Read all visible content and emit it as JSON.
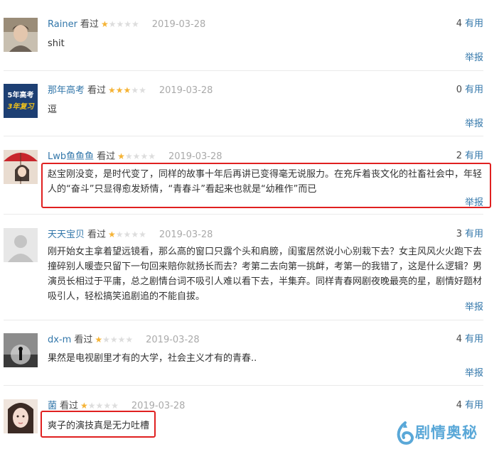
{
  "reviews": [
    {
      "username": "Rainer",
      "watched_label": "看过",
      "rating": 1,
      "date": "2019-03-28",
      "useful_count": "4",
      "useful_label": "有用",
      "content": "shit",
      "report_label": "举报"
    },
    {
      "username": "那年高考",
      "watched_label": "看过",
      "rating": 3,
      "date": "2019-03-28",
      "useful_count": "0",
      "useful_label": "有用",
      "content": "逗",
      "report_label": "举报",
      "avatar_text": [
        "5年高考",
        "3年复习"
      ]
    },
    {
      "username": "Lwb鱼鱼鱼",
      "watched_label": "看过",
      "rating": 1,
      "date": "2019-03-28",
      "useful_count": "2",
      "useful_label": "有用",
      "content": "赵宝刚没变，是时代变了，同样的故事十年后再讲已变得毫无说服力。在充斥着丧文化的社畜社会中，年轻人的“奋斗”只显得愈发矫情，“青春斗”看起来也就是“幼稚作”而已",
      "report_label": "举报"
    },
    {
      "username": "天天宝贝",
      "watched_label": "看过",
      "rating": 1,
      "date": "2019-03-28",
      "useful_count": "3",
      "useful_label": "有用",
      "content": "刚开始女主拿着望远镜看，那么高的窗口只露个头和肩膀，闺蜜居然说小心别栽下去？女主风风火火跑下去撞碎别人暖壶只留下一句回来赔你就扬长而去？考第二去向第一挑衅，考第一的我错了，这是什么逻辑？男演员长相过于平庸，总之剧情台词不吸引人难以看下去，半集弃。同样青春网剧夜晚最亮的星，剧情好题材吸引人，轻松搞笑追剧追的不能自拔。",
      "report_label": "举报"
    },
    {
      "username": "dx-m",
      "watched_label": "看过",
      "rating": 1,
      "date": "2019-03-28",
      "useful_count": "4",
      "useful_label": "有用",
      "content": "果然是电视剧里才有的大学，社会主义才有的青春..",
      "report_label": "举报"
    },
    {
      "username": "菌",
      "watched_label": "看过",
      "rating": 1,
      "date": "2019-03-28",
      "useful_count": "4",
      "useful_label": "有用",
      "content": "爽子的演技真是无力吐槽"
    }
  ],
  "watermark": {
    "text": "剧情奥秘"
  },
  "colors": {
    "link": "#3377aa",
    "star": "#f5b335",
    "highlight": "#e02020"
  }
}
